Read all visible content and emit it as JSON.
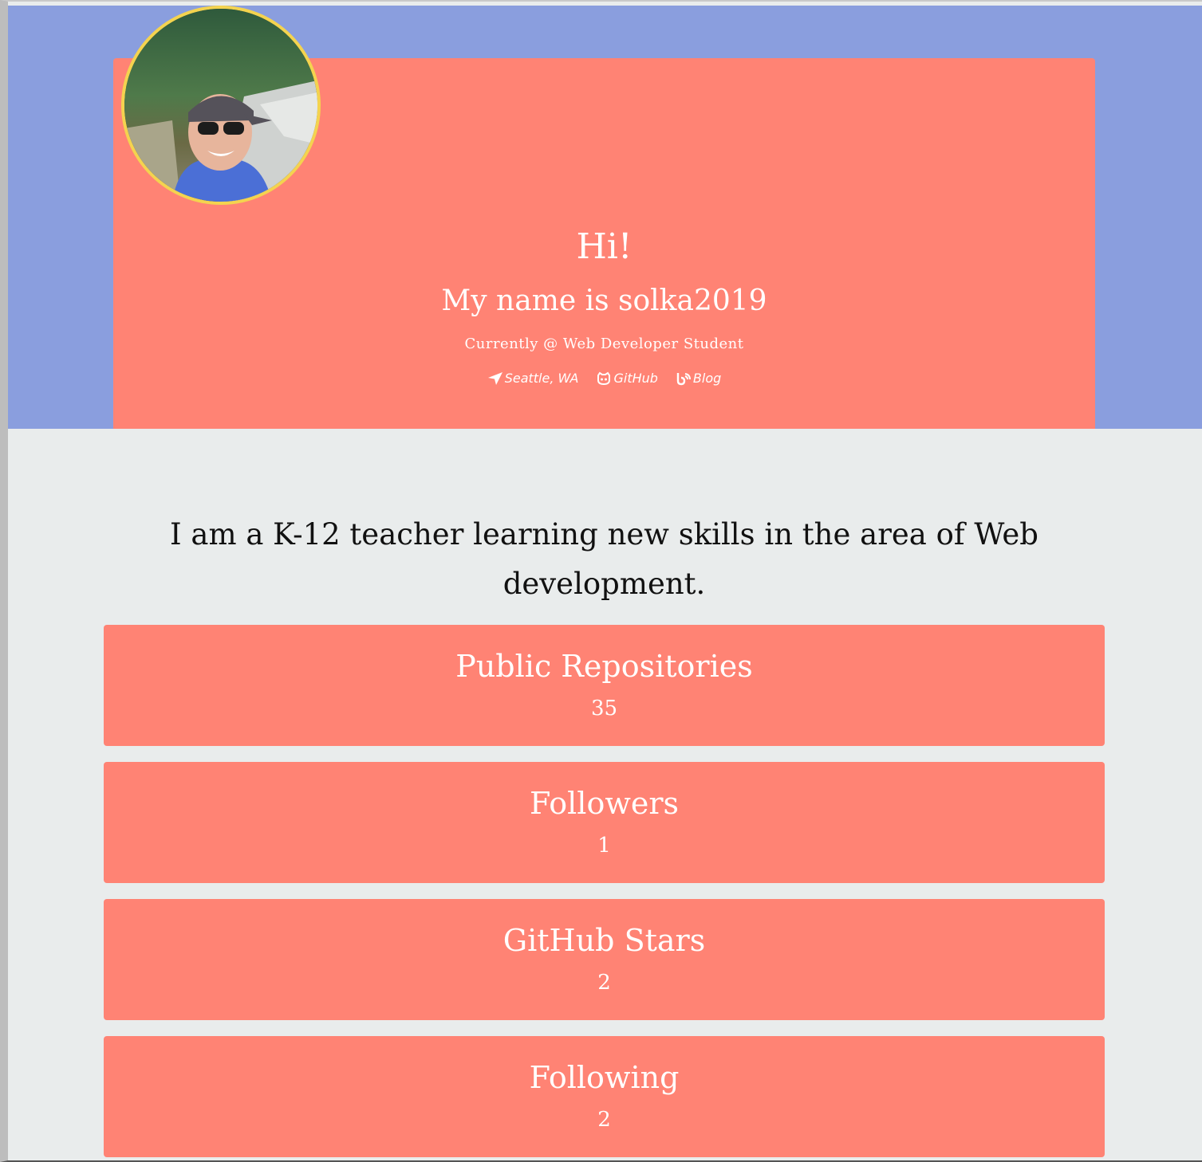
{
  "profile": {
    "greeting": "Hi!",
    "name_line": "My name is solka2019",
    "currently": "Currently @ Web Developer Student",
    "avatar_border_color": "#f4d34f"
  },
  "links": {
    "location": {
      "label": "Seattle, WA",
      "icon": "location-arrow-icon"
    },
    "github": {
      "label": "GitHub",
      "icon": "github-icon"
    },
    "blog": {
      "label": "Blog",
      "icon": "blog-icon"
    }
  },
  "bio": "I am a K-12 teacher learning new skills in the area of Web development.",
  "stats": [
    {
      "title": "Public Repositories",
      "value": "35"
    },
    {
      "title": "Followers",
      "value": "1"
    },
    {
      "title": "GitHub Stars",
      "value": "2"
    },
    {
      "title": "Following",
      "value": "2"
    }
  ],
  "colors": {
    "header_band": "#8a9ede",
    "card": "#ff8374",
    "page_background": "#e9ecec"
  }
}
